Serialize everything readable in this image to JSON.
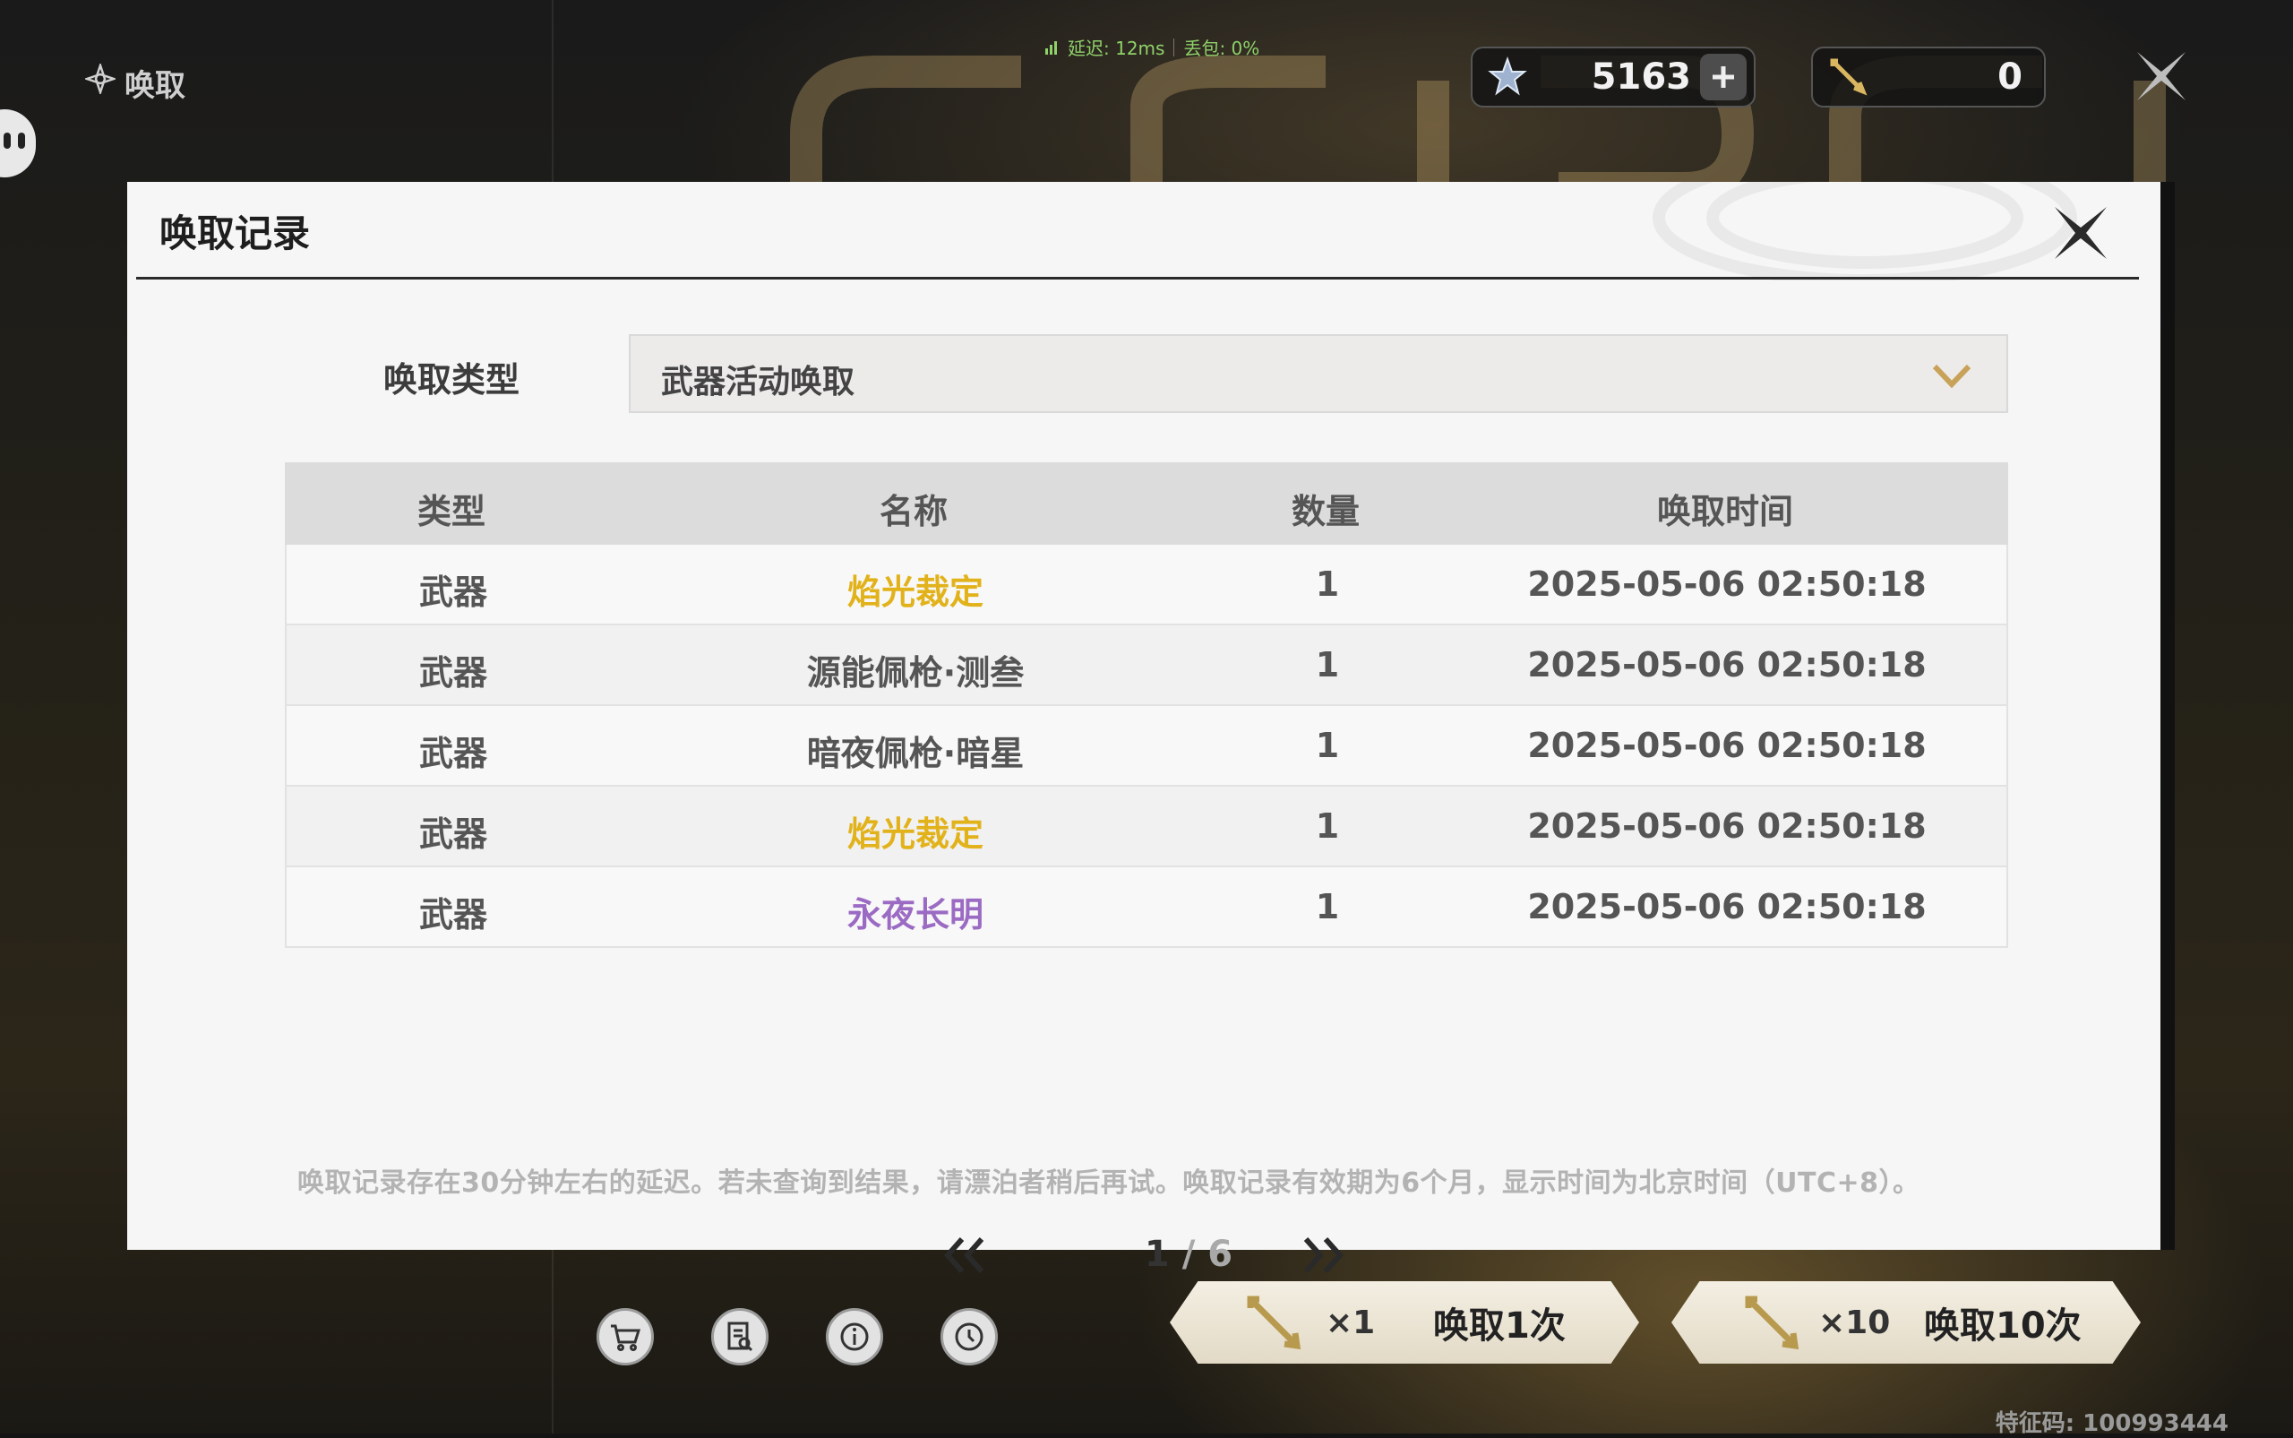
{
  "topbar": {
    "screen_title": "唤取",
    "net_latency": "延迟: 12ms",
    "net_loss": "丢包: 0%",
    "currency_1_value": "5163",
    "currency_2_value": "0"
  },
  "modal": {
    "title": "唤取记录",
    "type_label": "唤取类型",
    "type_selected": "武器活动唤取",
    "columns": [
      "类型",
      "名称",
      "数量",
      "唤取时间"
    ],
    "rows": [
      {
        "type": "武器",
        "name": "焰光裁定",
        "qty": "1",
        "time": "2025-05-06 02:50:18",
        "color": "#e2b21b"
      },
      {
        "type": "武器",
        "name": "源能佩枪·测叁",
        "qty": "1",
        "time": "2025-05-06 02:50:18",
        "color": "#555555"
      },
      {
        "type": "武器",
        "name": "暗夜佩枪·暗星",
        "qty": "1",
        "time": "2025-05-06 02:50:18",
        "color": "#555555"
      },
      {
        "type": "武器",
        "name": "焰光裁定",
        "qty": "1",
        "time": "2025-05-06 02:50:18",
        "color": "#e2b21b"
      },
      {
        "type": "武器",
        "name": "永夜长明",
        "qty": "1",
        "time": "2025-05-06 02:50:18",
        "color": "#9b6bc4"
      }
    ],
    "note": "唤取记录存在30分钟左右的延迟。若未查询到结果，请漂泊者稍后再试。唤取记录有效期为6个月，显示时间为北京时间（UTC+8）。",
    "page_current": "1",
    "page_separator": "/",
    "page_total": "6"
  },
  "bottom": {
    "pull_1_mult": "×1",
    "pull_1_label": "唤取1次",
    "pull_10_mult": "×10",
    "pull_10_label": "唤取10次",
    "serial": "特征码: 100993444"
  },
  "colors": {
    "accent_gold": "#e2b21b",
    "accent_purple": "#9b6bc4",
    "chevron": "#c9a25a"
  },
  "icons": {
    "screen_title": "compass-star-icon",
    "currency_1": "star-crystal-icon",
    "currency_1_add": "plus-icon",
    "currency_2": "golden-arrow-icon",
    "close": "close-x-icon",
    "select": "chevron-down-icon",
    "prev": "double-chevron-left-icon",
    "next": "double-chevron-right-icon",
    "tools": [
      "shop-cart-icon",
      "details-list-icon",
      "info-icon",
      "history-clock-icon"
    ]
  }
}
